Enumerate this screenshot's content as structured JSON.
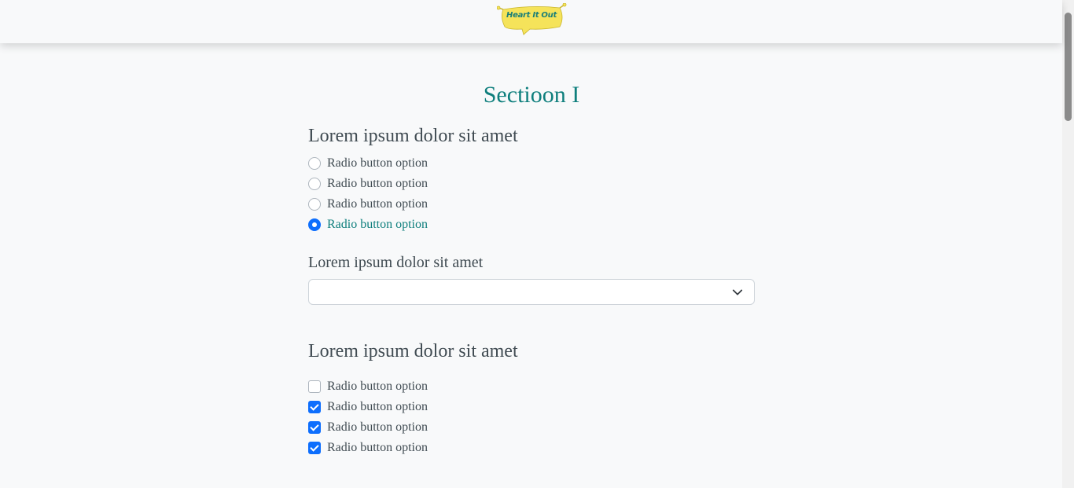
{
  "header": {
    "logo_text": "Heart It Out",
    "logo_color": "#f5e35a"
  },
  "section": {
    "title": "Sectioon I"
  },
  "question1": {
    "label": "Lorem ipsum dolor sit amet",
    "options": [
      {
        "label": "Radio button option",
        "checked": false
      },
      {
        "label": "Radio button option",
        "checked": false
      },
      {
        "label": "Radio button option",
        "checked": false
      },
      {
        "label": "Radio button option",
        "checked": true
      }
    ]
  },
  "question2": {
    "label": "Lorem ipsum dolor sit amet",
    "select_value": "",
    "icon": "chevron-down-icon"
  },
  "question3": {
    "label": "Lorem ipsum dolor sit amet",
    "options": [
      {
        "label": "Radio button option",
        "checked": false
      },
      {
        "label": "Radio button option",
        "checked": true
      },
      {
        "label": "Radio button option",
        "checked": true
      },
      {
        "label": "Radio button option",
        "checked": true
      }
    ]
  },
  "colors": {
    "accent": "#0f7f7d",
    "control": "#0d6efd",
    "text": "#404b52"
  }
}
